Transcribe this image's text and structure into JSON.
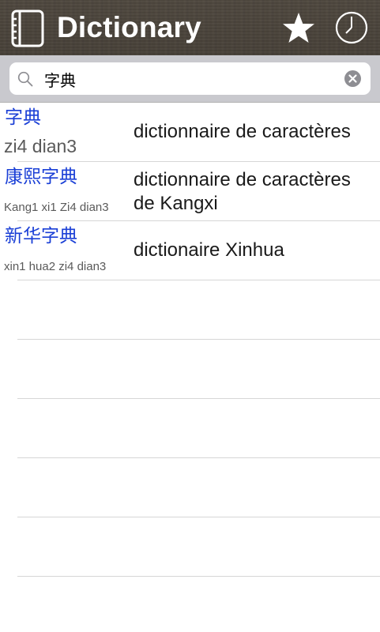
{
  "header": {
    "title": "Dictionary",
    "icons": [
      "book-icon",
      "star-icon",
      "clock-icon"
    ]
  },
  "search": {
    "value": "字典",
    "placeholder": ""
  },
  "results": [
    {
      "hanzi": "字典",
      "pinyin": "zi4 dian3",
      "definition": "dictionnaire de caractères"
    },
    {
      "hanzi": "康熙字典",
      "pinyin": "Kang1 xi1 Zi4 dian3",
      "definition": "dictionnaire de caractères de Kangxi"
    },
    {
      "hanzi": "新华字典",
      "pinyin": "xin1 hua2 zi4 dian3",
      "definition": "dictionaire Xinhua"
    }
  ],
  "colors": {
    "hanzi": "#1a3fd6",
    "pinyin": "#5a5a5a",
    "header_text": "#ffffff",
    "search_bar_bg": "#c9c9ce"
  }
}
